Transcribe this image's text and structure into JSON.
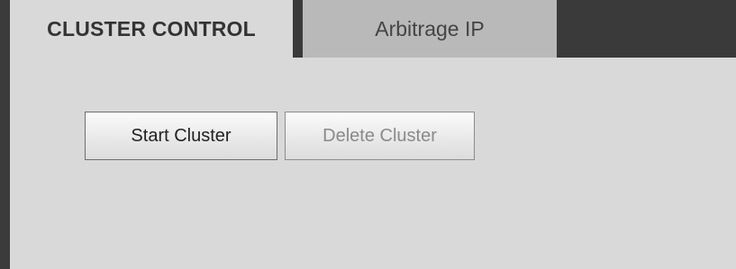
{
  "tabs": [
    {
      "label": "CLUSTER CONTROL",
      "active": true
    },
    {
      "label": "Arbitrage IP",
      "active": false
    }
  ],
  "buttons": {
    "start_label": "Start Cluster",
    "delete_label": "Delete Cluster",
    "delete_enabled": false
  },
  "colors": {
    "background": "#d9d9d9",
    "tabbar": "#3a3a3a",
    "inactive_tab": "#b9b9b9"
  }
}
